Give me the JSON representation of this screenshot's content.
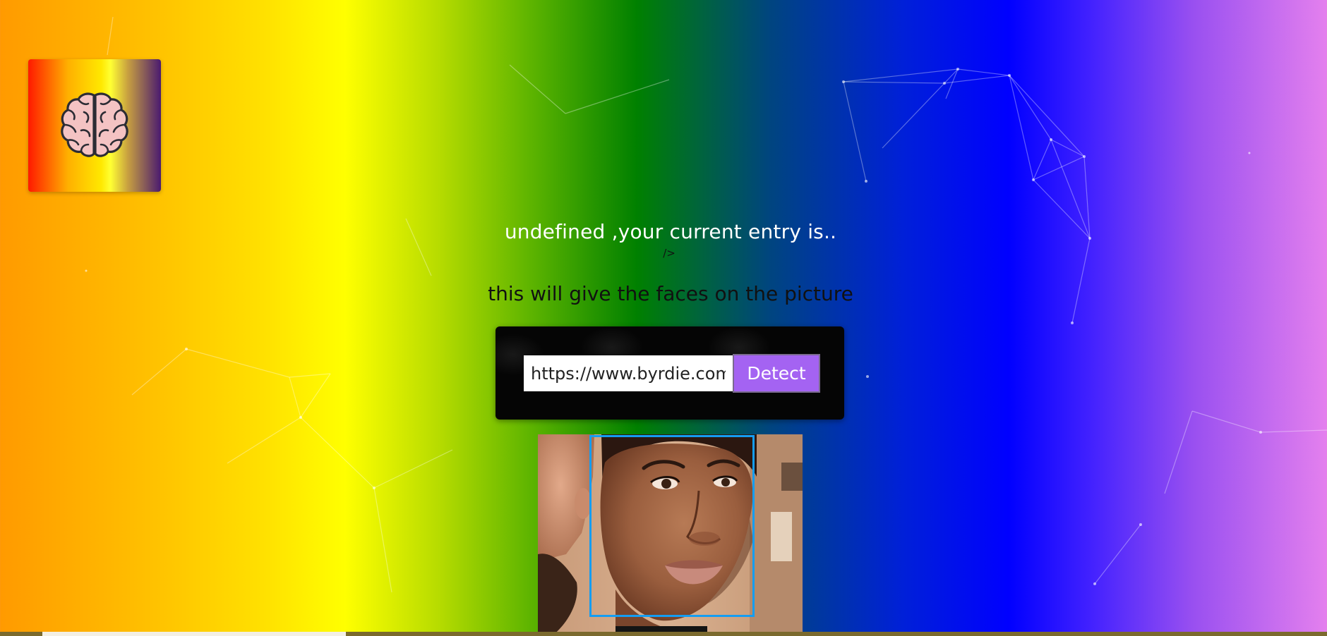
{
  "greeting": {
    "rank_text": "undefined ,your current entry is..",
    "stray_markup": "/>"
  },
  "tagline": "this will give the faces on the picture",
  "form": {
    "url_value": "https://www.byrdie.com/",
    "detect_label": "Detect"
  },
  "logo": {
    "icon": "brain-icon"
  },
  "colors": {
    "detect_button": "#a463f2",
    "face_box": "#149df2",
    "form_background": "#050505"
  }
}
